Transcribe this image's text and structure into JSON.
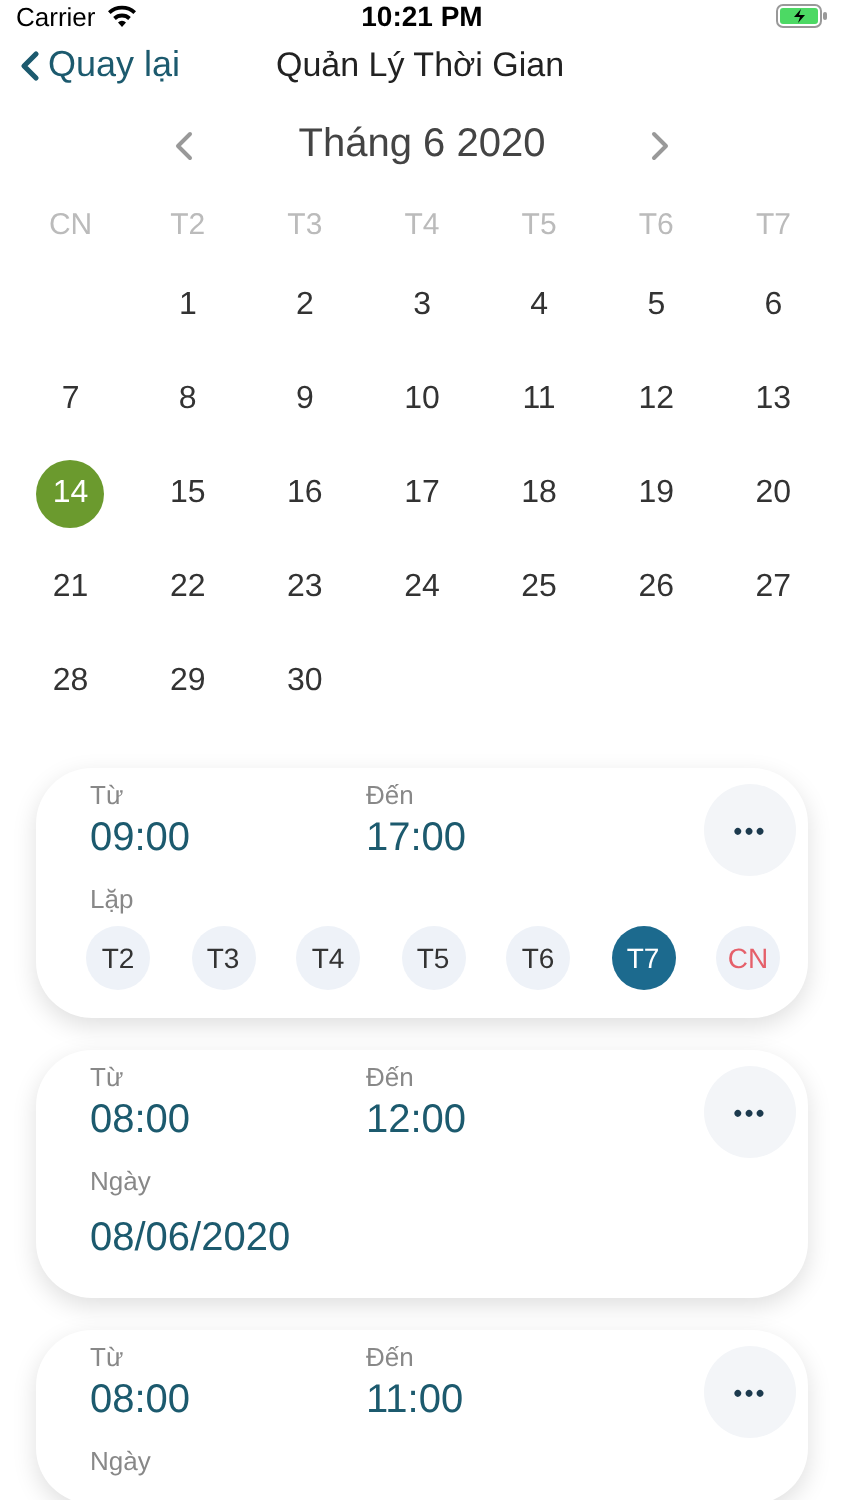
{
  "status_bar": {
    "carrier": "Carrier",
    "time": "10:21 PM"
  },
  "nav": {
    "back": "Quay lại",
    "title": "Quản Lý Thời Gian"
  },
  "calendar": {
    "month": "Tháng 6 2020",
    "weekdays": [
      {
        "label": "CN"
      },
      {
        "label": "T2"
      },
      {
        "label": "T3"
      },
      {
        "label": "T4"
      },
      {
        "label": "T5"
      },
      {
        "label": "T6"
      },
      {
        "label": "T7"
      }
    ],
    "weeks": [
      {
        "right_aligned": true,
        "days": [
          {
            "label": "1",
            "selected": false
          },
          {
            "label": "2",
            "selected": false
          },
          {
            "label": "3",
            "selected": false
          },
          {
            "label": "4",
            "selected": false
          },
          {
            "label": "5",
            "selected": false
          },
          {
            "label": "6",
            "selected": false
          }
        ]
      },
      {
        "days": [
          {
            "label": "7",
            "selected": false
          },
          {
            "label": "8",
            "selected": false
          },
          {
            "label": "9",
            "selected": false
          },
          {
            "label": "10",
            "selected": false
          },
          {
            "label": "11",
            "selected": false
          },
          {
            "label": "12",
            "selected": false
          },
          {
            "label": "13",
            "selected": false
          }
        ]
      },
      {
        "days": [
          {
            "label": "14",
            "selected": true
          },
          {
            "label": "15",
            "selected": false
          },
          {
            "label": "16",
            "selected": false
          },
          {
            "label": "17",
            "selected": false
          },
          {
            "label": "18",
            "selected": false
          },
          {
            "label": "19",
            "selected": false
          },
          {
            "label": "20",
            "selected": false
          }
        ]
      },
      {
        "days": [
          {
            "label": "21",
            "selected": false
          },
          {
            "label": "22",
            "selected": false
          },
          {
            "label": "23",
            "selected": false
          },
          {
            "label": "24",
            "selected": false
          },
          {
            "label": "25",
            "selected": false
          },
          {
            "label": "26",
            "selected": false
          },
          {
            "label": "27",
            "selected": false
          }
        ]
      },
      {
        "right_aligned": false,
        "days": [
          {
            "label": "28",
            "selected": false
          },
          {
            "label": "29",
            "selected": false
          },
          {
            "label": "30",
            "selected": false
          }
        ]
      }
    ]
  },
  "slots": [
    {
      "kind": "repeat",
      "from_label": "Từ",
      "from": "09:00",
      "to_label": "Đến",
      "to": "17:00",
      "more": "•••",
      "repeat_label": "Lặp",
      "days": [
        {
          "label": "T2",
          "selected": false,
          "weekend": false
        },
        {
          "label": "T3",
          "selected": false,
          "weekend": false
        },
        {
          "label": "T4",
          "selected": false,
          "weekend": false
        },
        {
          "label": "T5",
          "selected": false,
          "weekend": false
        },
        {
          "label": "T6",
          "selected": false,
          "weekend": false
        },
        {
          "label": "T7",
          "selected": true,
          "weekend": false
        },
        {
          "label": "CN",
          "selected": false,
          "weekend": true
        }
      ]
    },
    {
      "kind": "date",
      "from_label": "Từ",
      "from": "08:00",
      "to_label": "Đến",
      "to": "12:00",
      "more": "•••",
      "date_label": "Ngày",
      "date": "08/06/2020"
    },
    {
      "kind": "date",
      "from_label": "Từ",
      "from": "08:00",
      "to_label": "Đến",
      "to": "11:00",
      "more": "•••",
      "date_label": "Ngày"
    }
  ]
}
